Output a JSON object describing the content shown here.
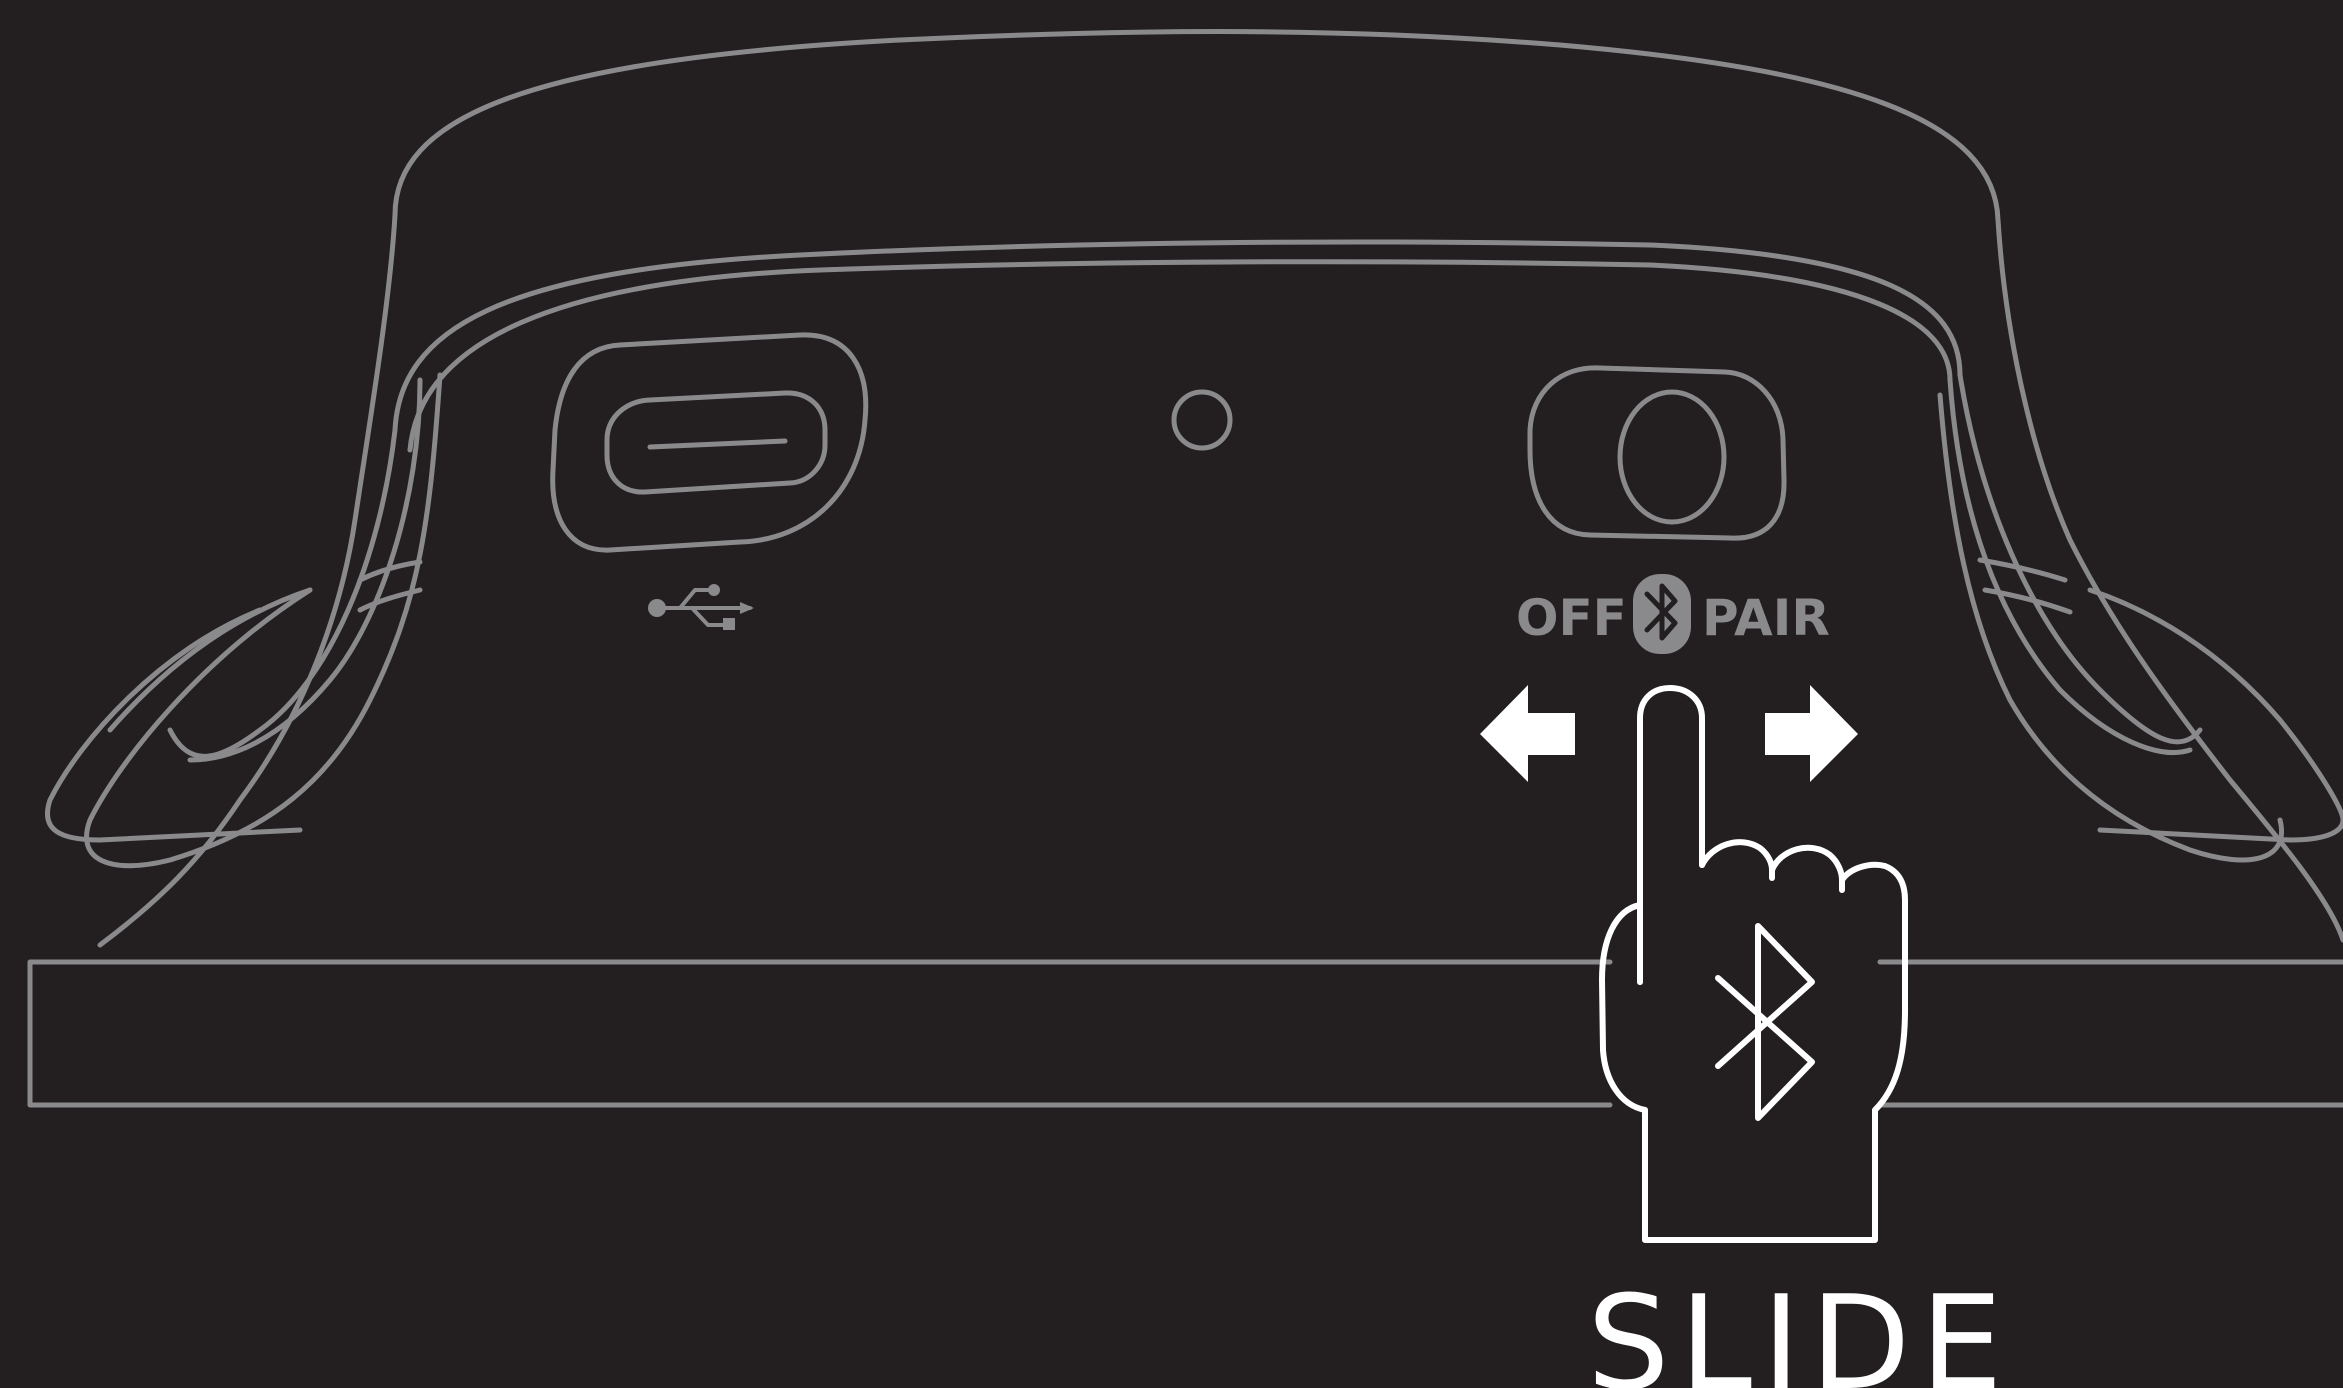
{
  "switch_labels": {
    "off": "OFF",
    "pair": "PAIR"
  },
  "instruction": "SLIDE",
  "icons": [
    "usb-icon",
    "bluetooth-icon",
    "arrow-left-icon",
    "arrow-right-icon",
    "hand-pointer-icon"
  ],
  "colors": {
    "background": "#231f20",
    "line_art": "#8a8a8c",
    "highlight": "#ffffff"
  }
}
